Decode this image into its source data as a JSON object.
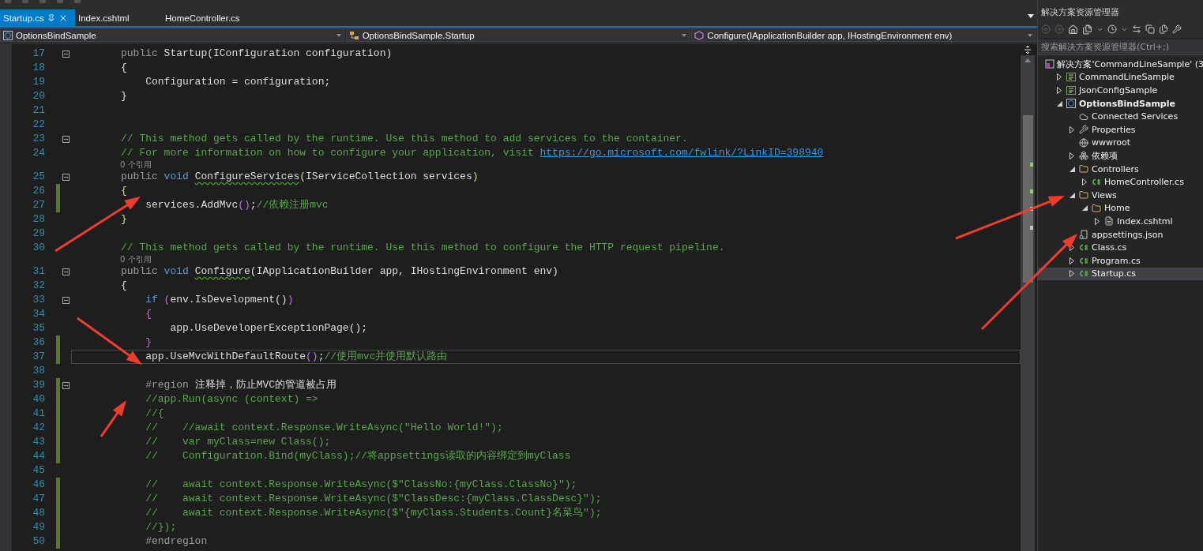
{
  "tabs": [
    {
      "label": "Startup.cs",
      "selected": true,
      "pinned": true
    },
    {
      "label": "Index.cshtml",
      "selected": false,
      "pinned": false
    },
    {
      "label": "HomeController.cs",
      "selected": false,
      "pinned": false
    }
  ],
  "navigation": [
    {
      "kind": "project",
      "text": "OptionsBindSample"
    },
    {
      "kind": "class",
      "text": "OptionsBindSample.Startup"
    },
    {
      "kind": "method",
      "text": "Configure(IApplicationBuilder app, IHostingEnvironment env)"
    }
  ],
  "editor": {
    "lines": [
      {
        "kind": "code",
        "number": "17",
        "changed": false,
        "fold": true,
        "current": false,
        "tokens": [
          {
            "kind": "dim",
            "text": "public "
          },
          {
            "kind": "plain",
            "text": "Startup(IConfiguration configuration)"
          }
        ]
      },
      {
        "kind": "code",
        "number": "18",
        "changed": false,
        "fold": false,
        "current": false,
        "tokens": [
          {
            "kind": "plain",
            "text": "{"
          }
        ]
      },
      {
        "kind": "code",
        "number": "19",
        "changed": false,
        "fold": false,
        "current": false,
        "tokens": [
          {
            "kind": "plain",
            "text": "    Configuration = configuration;"
          }
        ]
      },
      {
        "kind": "code",
        "number": "20",
        "changed": false,
        "fold": false,
        "current": false,
        "tokens": [
          {
            "kind": "plain",
            "text": "}"
          }
        ]
      },
      {
        "kind": "code",
        "number": "21",
        "changed": false,
        "fold": false,
        "current": false
      },
      {
        "kind": "code",
        "number": "22",
        "changed": false,
        "fold": false,
        "current": false
      },
      {
        "kind": "code",
        "number": "23",
        "changed": false,
        "fold": true,
        "current": false,
        "tokens": [
          {
            "kind": "comment",
            "text": "// This method gets called by the runtime. Use this method to add services to the container."
          }
        ]
      },
      {
        "kind": "code",
        "number": "24",
        "changed": false,
        "fold": false,
        "current": false,
        "tokens": [
          {
            "kind": "comment",
            "text": "// For more information on how to configure your application, visit "
          },
          {
            "kind": "link",
            "text": "https://go.microsoft.com/fwlink/?LinkID=398940"
          }
        ]
      },
      {
        "kind": "lens",
        "text": "0 个引用"
      },
      {
        "kind": "code",
        "number": "25",
        "changed": false,
        "fold": true,
        "current": false,
        "tokens": [
          {
            "kind": "dim",
            "text": "public "
          },
          {
            "kind": "kw",
            "text": "void "
          },
          {
            "kind": "method",
            "text": "ConfigureServices"
          },
          {
            "kind": "bracket1",
            "text": "("
          },
          {
            "kind": "plain",
            "text": "IServiceCollection services"
          },
          {
            "kind": "bracket1",
            "text": ")"
          }
        ]
      },
      {
        "kind": "code",
        "number": "26",
        "changed": true,
        "fold": false,
        "current": false,
        "tokens": [
          {
            "kind": "bracket1",
            "text": "{"
          }
        ]
      },
      {
        "kind": "code",
        "number": "27",
        "changed": true,
        "fold": false,
        "current": false,
        "tokens": [
          {
            "kind": "plain",
            "text": "    services.AddMvc"
          },
          {
            "kind": "bracket2",
            "text": "()"
          },
          {
            "kind": "plain",
            "text": ";"
          },
          {
            "kind": "comment",
            "text": "//依赖注册mvc"
          }
        ]
      },
      {
        "kind": "code",
        "number": "28",
        "changed": false,
        "fold": false,
        "current": false,
        "tokens": [
          {
            "kind": "bracket1",
            "text": "}"
          }
        ]
      },
      {
        "kind": "code",
        "number": "29",
        "changed": false,
        "fold": false,
        "current": false
      },
      {
        "kind": "code",
        "number": "30",
        "changed": false,
        "fold": false,
        "current": false,
        "tokens": [
          {
            "kind": "comment",
            "text": "// This method gets called by the runtime. Use this method to configure the HTTP request pipeline."
          }
        ]
      },
      {
        "kind": "lens",
        "text": "0 个引用"
      },
      {
        "kind": "code",
        "number": "31",
        "changed": false,
        "fold": true,
        "current": false,
        "tokens": [
          {
            "kind": "dim",
            "text": "public "
          },
          {
            "kind": "kw",
            "text": "void "
          },
          {
            "kind": "method",
            "text": "Configure"
          },
          {
            "kind": "plain",
            "text": "(IApplicationBuilder app, IHostingEnvironment env)"
          }
        ]
      },
      {
        "kind": "code",
        "number": "32",
        "changed": false,
        "fold": false,
        "current": false,
        "tokens": [
          {
            "kind": "plain",
            "text": "{"
          }
        ]
      },
      {
        "kind": "code",
        "number": "33",
        "changed": false,
        "fold": true,
        "current": false,
        "tokens": [
          {
            "kind": "kw",
            "text": "    if "
          },
          {
            "kind": "bracket2",
            "text": "("
          },
          {
            "kind": "plain",
            "text": "env.IsDevelopment()"
          },
          {
            "kind": "bracket2",
            "text": ")"
          }
        ]
      },
      {
        "kind": "code",
        "number": "34",
        "changed": false,
        "fold": false,
        "current": false,
        "tokens": [
          {
            "kind": "bracket2",
            "text": "    {"
          }
        ]
      },
      {
        "kind": "code",
        "number": "35",
        "changed": false,
        "fold": false,
        "current": false,
        "tokens": [
          {
            "kind": "plain",
            "text": "        app.UseDeveloperExceptionPage();"
          }
        ]
      },
      {
        "kind": "code",
        "number": "36",
        "changed": true,
        "fold": false,
        "current": false,
        "tokens": [
          {
            "kind": "bracket2",
            "text": "    }"
          }
        ]
      },
      {
        "kind": "code",
        "number": "37",
        "changed": true,
        "fold": false,
        "current": true,
        "tokens": [
          {
            "kind": "plain",
            "text": "    app.UseMvcWithDefaultRoute"
          },
          {
            "kind": "bracket2",
            "text": "()"
          },
          {
            "kind": "plain",
            "text": ";"
          },
          {
            "kind": "comment",
            "text": "//使用mvc并使用默认路由"
          }
        ]
      },
      {
        "kind": "code",
        "number": "38",
        "changed": false,
        "fold": false,
        "current": false
      },
      {
        "kind": "code",
        "number": "39",
        "changed": true,
        "fold": true,
        "current": false,
        "tokens": [
          {
            "kind": "region",
            "text": "    #region "
          },
          {
            "kind": "plain",
            "text": "注释掉，防止MVC的管道被占用"
          }
        ]
      },
      {
        "kind": "code",
        "number": "40",
        "changed": true,
        "fold": false,
        "current": false,
        "tokens": [
          {
            "kind": "comment",
            "text": "    //app.Run(async (context) =>"
          }
        ]
      },
      {
        "kind": "code",
        "number": "41",
        "changed": true,
        "fold": false,
        "current": false,
        "tokens": [
          {
            "kind": "comment",
            "text": "    //{"
          }
        ]
      },
      {
        "kind": "code",
        "number": "42",
        "changed": true,
        "fold": false,
        "current": false,
        "tokens": [
          {
            "kind": "comment",
            "text": "    //    //await context.Response.WriteAsync(\"Hello World!\");"
          }
        ]
      },
      {
        "kind": "code",
        "number": "43",
        "changed": true,
        "fold": false,
        "current": false,
        "tokens": [
          {
            "kind": "comment",
            "text": "    //    var myClass=new Class();"
          }
        ]
      },
      {
        "kind": "code",
        "number": "44",
        "changed": true,
        "fold": false,
        "current": false,
        "tokens": [
          {
            "kind": "comment",
            "text": "    //    Configuration.Bind(myClass);//将appsettings读取的内容绑定到myClass"
          }
        ]
      },
      {
        "kind": "code",
        "number": "45",
        "changed": false,
        "fold": false,
        "current": false
      },
      {
        "kind": "code",
        "number": "46",
        "changed": true,
        "fold": false,
        "current": false,
        "tokens": [
          {
            "kind": "comment",
            "text": "    //    await context.Response.WriteAsync($\"ClassNo:{myClass.ClassNo}\");"
          }
        ]
      },
      {
        "kind": "code",
        "number": "47",
        "changed": true,
        "fold": false,
        "current": false,
        "tokens": [
          {
            "kind": "comment",
            "text": "    //    await context.Response.WriteAsync($\"ClassDesc:{myClass.ClassDesc}\");"
          }
        ]
      },
      {
        "kind": "code",
        "number": "48",
        "changed": true,
        "fold": false,
        "current": false,
        "tokens": [
          {
            "kind": "comment",
            "text": "    //    await context.Response.WriteAsync($\"{myClass.Students.Count}名菜鸟\");"
          }
        ]
      },
      {
        "kind": "code",
        "number": "49",
        "changed": true,
        "fold": false,
        "current": false,
        "tokens": [
          {
            "kind": "comment",
            "text": "    //});"
          }
        ]
      },
      {
        "kind": "code",
        "number": "50",
        "changed": true,
        "fold": false,
        "current": false,
        "tokens": [
          {
            "kind": "region",
            "text": "    #endregion"
          }
        ]
      }
    ]
  },
  "solution_explorer": {
    "title": "解决方案资源管理器",
    "search": {
      "placeholder": "搜索解决方案资源管理器(Ctrl+;)"
    },
    "tree": [
      {
        "label": "解决方案'CommandLineSample' (3",
        "kind": "solution",
        "selected": false,
        "bold": false,
        "children": [
          {
            "label": "CommandLineSample",
            "kind": "csproj",
            "expanded": false,
            "selected": false,
            "bold": false
          },
          {
            "label": "JsonConfigSample",
            "kind": "csproj",
            "expanded": false,
            "selected": false,
            "bold": false
          },
          {
            "label": "OptionsBindSample",
            "kind": "webproject",
            "expanded": true,
            "selected": false,
            "bold": true,
            "children": [
              {
                "label": "Connected Services",
                "kind": "cloud",
                "selected": false,
                "bold": false
              },
              {
                "label": "Properties",
                "kind": "wrench",
                "expanded": false,
                "selected": false,
                "bold": false
              },
              {
                "label": "wwwroot",
                "kind": "globe",
                "selected": false,
                "bold": false
              },
              {
                "label": "依赖项",
                "kind": "deps",
                "expanded": false,
                "selected": false,
                "bold": false
              },
              {
                "label": "Controllers",
                "kind": "folder",
                "expanded": true,
                "selected": false,
                "bold": false,
                "children": [
                  {
                    "label": "HomeController.cs",
                    "kind": "cs",
                    "expanded": false,
                    "selected": false,
                    "bold": false
                  }
                ]
              },
              {
                "label": "Views",
                "kind": "folder",
                "expanded": true,
                "selected": false,
                "bold": false,
                "children": [
                  {
                    "label": "Home",
                    "kind": "folder",
                    "expanded": true,
                    "selected": false,
                    "bold": false,
                    "children": [
                      {
                        "label": "Index.cshtml",
                        "kind": "page",
                        "expanded": false,
                        "selected": false,
                        "bold": false
                      }
                    ]
                  }
                ]
              },
              {
                "label": "appsettings.json",
                "kind": "json",
                "selected": false,
                "bold": false
              },
              {
                "label": "Class.cs",
                "kind": "cs",
                "expanded": false,
                "selected": false,
                "bold": false
              },
              {
                "label": "Program.cs",
                "kind": "cs",
                "expanded": false,
                "selected": false,
                "bold": false
              },
              {
                "label": "Startup.cs",
                "kind": "cs",
                "expanded": false,
                "selected": true,
                "bold": false
              }
            ]
          }
        ]
      }
    ]
  }
}
